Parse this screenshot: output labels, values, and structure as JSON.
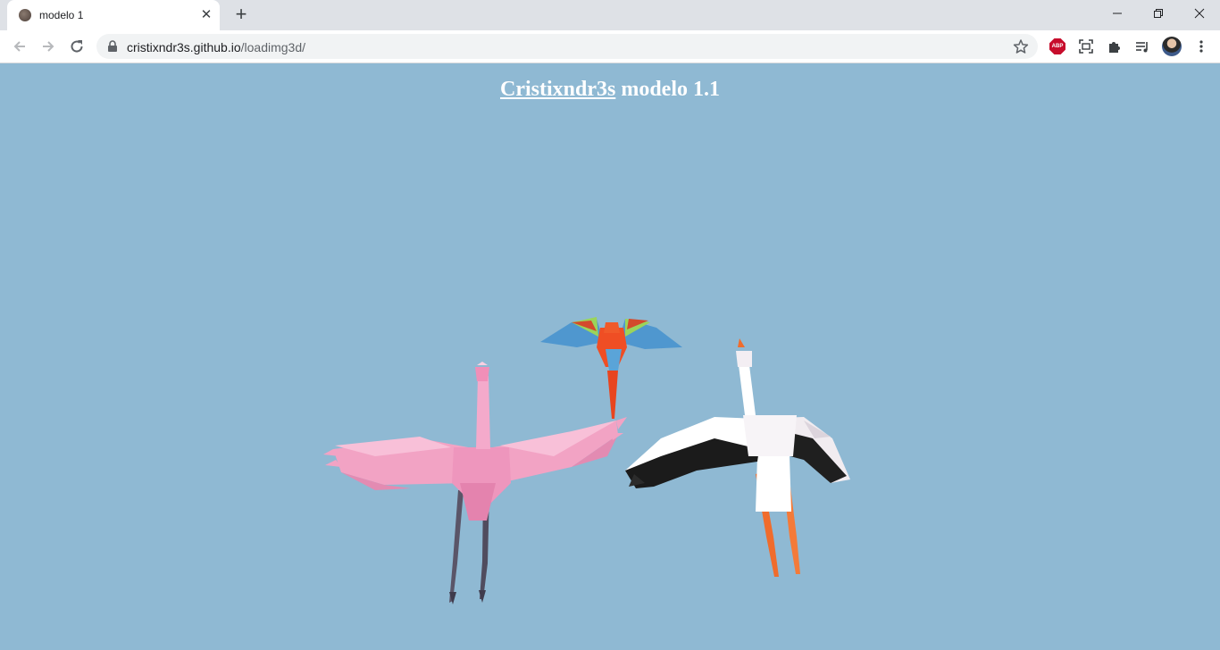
{
  "browser": {
    "tab": {
      "title": "modelo 1"
    },
    "url": {
      "host": "cristixndr3s.github.io",
      "path": "/loadimg3d/"
    },
    "extensions": {
      "abp_label": "ABP"
    }
  },
  "page": {
    "title_link": "Cristixndr3s",
    "title_rest": " modelo 1.1"
  },
  "scene": {
    "background_color": "#8fb9d3",
    "models": [
      "flamingo",
      "parrot",
      "stork"
    ]
  }
}
